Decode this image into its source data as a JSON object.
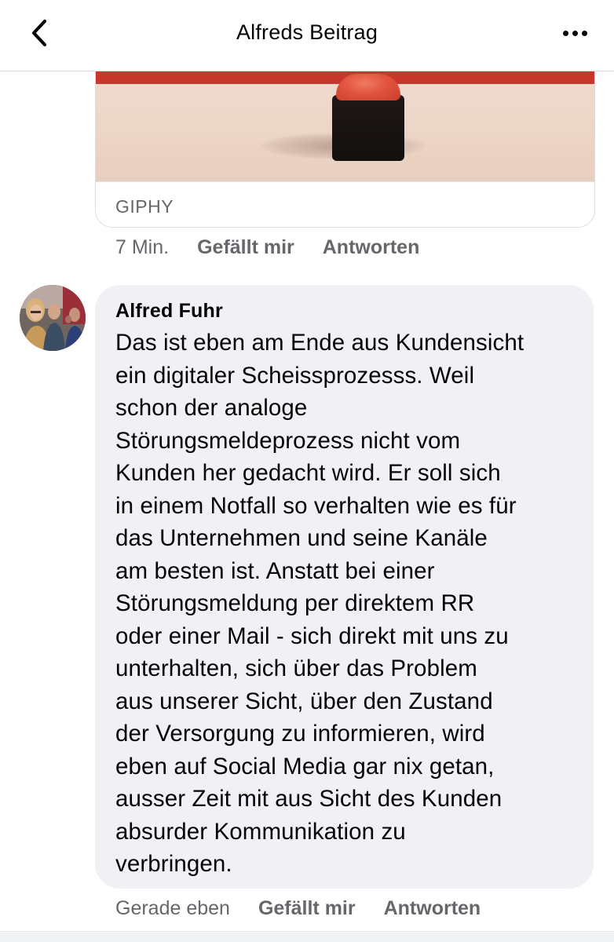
{
  "header": {
    "title": "Alfreds Beitrag",
    "back_icon": "chevron-left-icon",
    "more_icon": "more-horizontal-icon"
  },
  "gif": {
    "source_label": "GIPHY",
    "meta": {
      "time": "7 Min.",
      "like_label": "Gefällt mir",
      "reply_label": "Antworten"
    }
  },
  "comment": {
    "author": "Alfred Fuhr",
    "text": "Das ist eben am Ende aus Kundensicht\nein digitaler Scheissprozesss. Weil\nschon der analoge\nStörungsmeldeprozess nicht vom\nKunden her gedacht wird. Er soll sich\nin einem Notfall so verhalten wie es für\ndas Unternehmen und seine Kanäle\nam besten ist. Anstatt bei einer\nStörungsmeldung per direktem RR\noder einer Mail - sich direkt mit uns zu\nunterhalten, sich über das Problem\naus unserer Sicht, über den Zustand\nder Versorgung zu informieren, wird\neben auf Social Media gar nix getan,\nausser Zeit mit aus Sicht des Kunden\nabsurder Kommunikation zu\nverbringen.",
    "meta": {
      "time": "Gerade eben",
      "like_label": "Gefällt mir",
      "reply_label": "Antworten"
    }
  },
  "colors": {
    "bubble_bg": "#f0f0f5",
    "meta_text": "#65676b",
    "primary_text": "#050505"
  }
}
